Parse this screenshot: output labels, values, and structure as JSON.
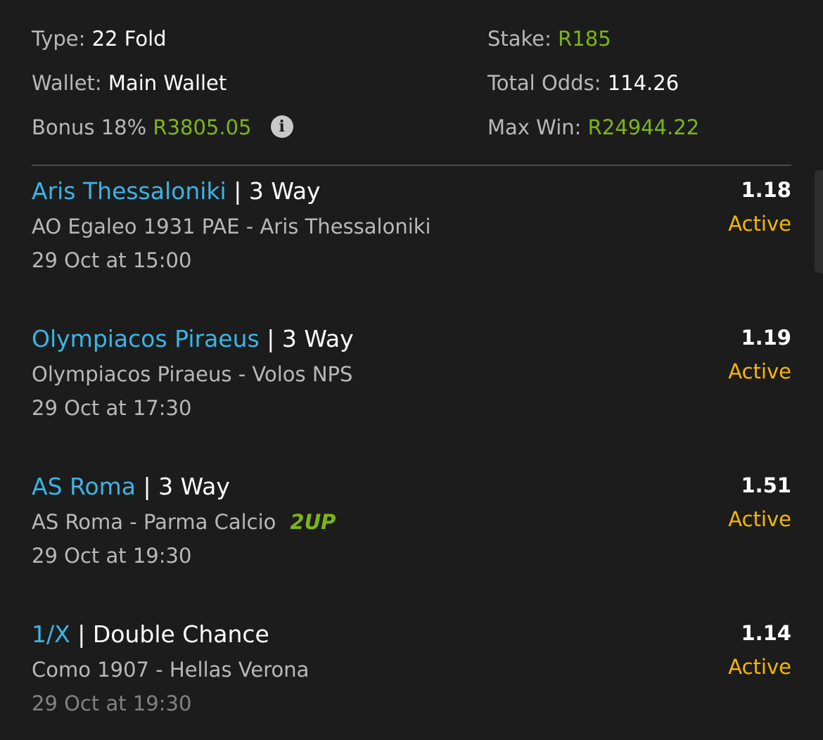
{
  "summary": {
    "type_label": "Type:",
    "type_value": "22 Fold",
    "wallet_label": "Wallet:",
    "wallet_value": "Main Wallet",
    "bonus_label": "Bonus 18%",
    "bonus_value": "R3805.05",
    "info_icon": "i",
    "stake_label": "Stake:",
    "stake_value": "R185",
    "total_odds_label": "Total Odds:",
    "total_odds_value": "114.26",
    "max_win_label": "Max Win:",
    "max_win_value": "R24944.22"
  },
  "selections": [
    {
      "pick": "Aris Thessaloniki",
      "sep": "|",
      "market": "3 Way",
      "match": "AO Egaleo 1931 PAE - Aris Thessaloniki",
      "badge": "",
      "time": "29 Oct at 15:00",
      "odds": "1.18",
      "status": "Active"
    },
    {
      "pick": "Olympiacos Piraeus",
      "sep": "|",
      "market": "3 Way",
      "match": "Olympiacos Piraeus - Volos NPS",
      "badge": "",
      "time": "29 Oct at 17:30",
      "odds": "1.19",
      "status": "Active"
    },
    {
      "pick": "AS Roma",
      "sep": "|",
      "market": "3 Way",
      "match": "AS Roma - Parma Calcio",
      "badge": "2UP",
      "time": "29 Oct at 19:30",
      "odds": "1.51",
      "status": "Active"
    },
    {
      "pick": "1/X",
      "sep": "|",
      "market": "Double Chance",
      "match": "Como 1907 - Hellas Verona",
      "badge": "",
      "time": "29 Oct at 19:30",
      "odds": "1.14",
      "status": "Active"
    }
  ],
  "colors": {
    "background": "#1c1c1c",
    "pick": "#3ab5e6",
    "money": "#7cb518",
    "status": "#f5b800"
  }
}
